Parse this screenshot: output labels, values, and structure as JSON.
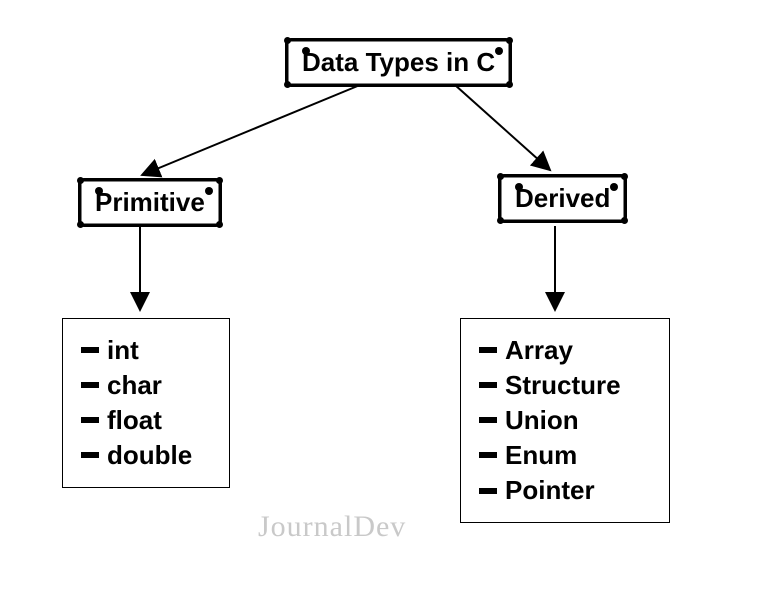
{
  "root": {
    "title": "Data Types in C"
  },
  "primitive": {
    "label": "Primitive",
    "items": [
      "int",
      "char",
      "float",
      "double"
    ]
  },
  "derived": {
    "label": "Derived",
    "items": [
      "Array",
      "Structure",
      "Union",
      "Enum",
      "Pointer"
    ]
  },
  "watermark": "JournalDev"
}
